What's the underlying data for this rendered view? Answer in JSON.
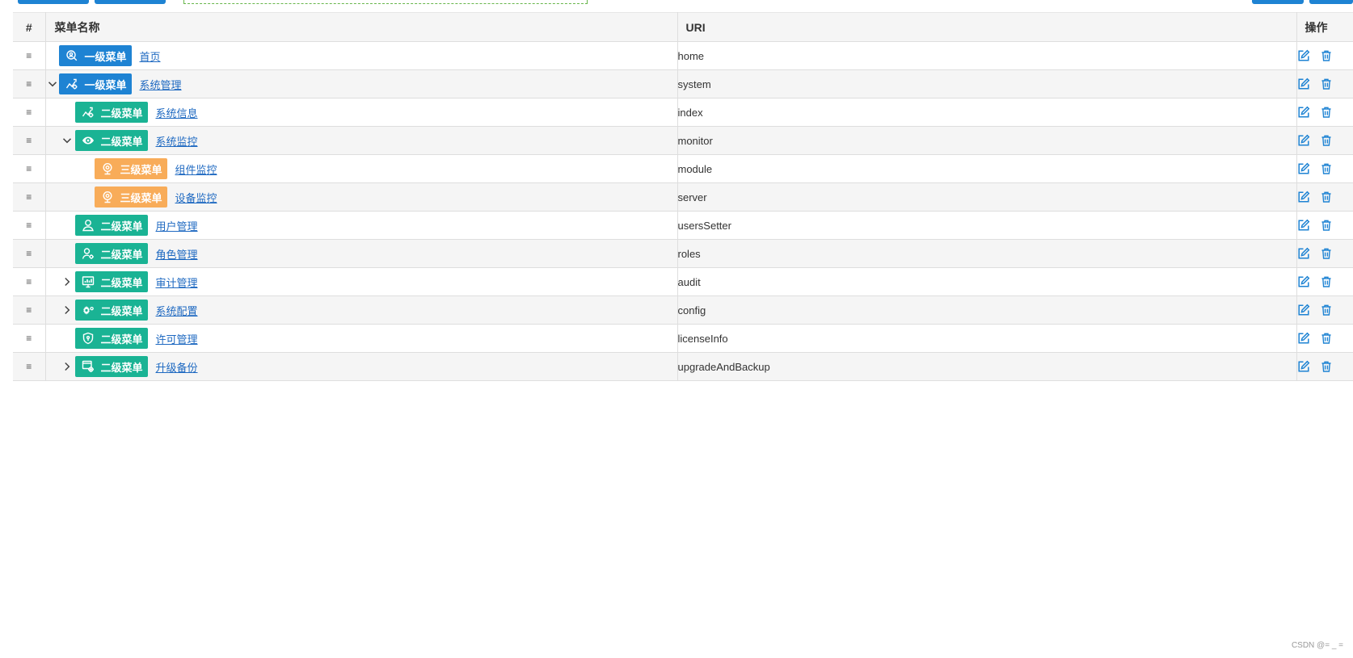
{
  "table": {
    "headers": {
      "index": "#",
      "name": "菜单名称",
      "uri": "URI",
      "ops": "操作"
    },
    "rows": [
      {
        "level": 1,
        "badge": "一级菜单",
        "icon": "search-person-icon",
        "name": "首页",
        "uri": "home",
        "expander": "none"
      },
      {
        "level": 1,
        "badge": "一级菜单",
        "icon": "chart-gear-icon",
        "name": "系统管理",
        "uri": "system",
        "expander": "expanded"
      },
      {
        "level": 2,
        "badge": "二级菜单",
        "icon": "chart-gear-icon",
        "name": "系统信息",
        "uri": "index",
        "expander": "none"
      },
      {
        "level": 2,
        "badge": "二级菜单",
        "icon": "eye-icon",
        "name": "系统监控",
        "uri": "monitor",
        "expander": "expanded"
      },
      {
        "level": 3,
        "badge": "三级菜单",
        "icon": "webcam-icon",
        "name": "组件监控",
        "uri": "module",
        "expander": "none"
      },
      {
        "level": 3,
        "badge": "三级菜单",
        "icon": "webcam-icon",
        "name": "设备监控",
        "uri": "server",
        "expander": "none"
      },
      {
        "level": 2,
        "badge": "二级菜单",
        "icon": "user-icon",
        "name": "用户管理",
        "uri": "usersSetter",
        "expander": "none"
      },
      {
        "level": 2,
        "badge": "二级菜单",
        "icon": "user-gear-icon",
        "name": "角色管理",
        "uri": "roles",
        "expander": "none"
      },
      {
        "level": 2,
        "badge": "二级菜单",
        "icon": "monitor-chart-icon",
        "name": "审计管理",
        "uri": "audit",
        "expander": "collapsed"
      },
      {
        "level": 2,
        "badge": "二级菜单",
        "icon": "gears-icon",
        "name": "系统配置",
        "uri": "config",
        "expander": "collapsed"
      },
      {
        "level": 2,
        "badge": "二级菜单",
        "icon": "shield-icon",
        "name": "许可管理",
        "uri": "licenseInfo",
        "expander": "none"
      },
      {
        "level": 2,
        "badge": "二级菜单",
        "icon": "window-gear-icon",
        "name": "升级备份",
        "uri": "upgradeAndBackup",
        "expander": "collapsed"
      }
    ],
    "drag_glyph": "≡"
  },
  "watermark": "CSDN @= _ =",
  "colors": {
    "level1": "#1e83d3",
    "level2": "#1ab394",
    "level3": "#f8ac59",
    "link": "#1e69c1",
    "action": "#1e83d3"
  }
}
